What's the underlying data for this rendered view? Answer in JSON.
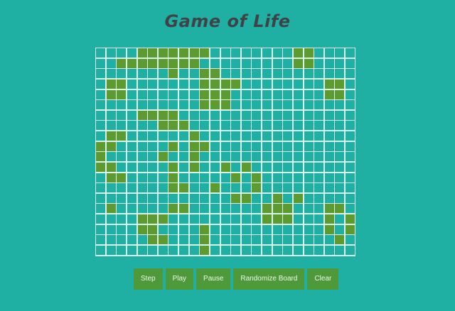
{
  "title": "Game of Life",
  "board": {
    "rows": 20,
    "cols": 25,
    "alive_color": "#5d9a2f",
    "dead_color": "#1fb0a3",
    "grid_color": "#d7f3e8",
    "grid": [
      "0000111111100000000110000",
      "0011111111000000000110000",
      "0000000100110000000000000",
      "0110000000111100000000110",
      "0110000000111000000000110",
      "0000000000111000000000000",
      "0000111100000000000000000",
      "0000001110000000000000000",
      "0110000001000000000000000",
      "1100000101100000000000000",
      "1000001001000000000000000",
      "1100000101001010000000000",
      "0110000100000101000000000",
      "0000000110010001000000000",
      "0000000000000110010100000",
      "0100000110000000111000110",
      "0000111000000000111000101",
      "0000110000100000000000101",
      "0000011000100000000000010",
      "0000000000100000000000000"
    ]
  },
  "controls": {
    "step_label": "Step",
    "play_label": "Play",
    "pause_label": "Pause",
    "randomize_label": "Randomize Board",
    "clear_label": "Clear"
  }
}
